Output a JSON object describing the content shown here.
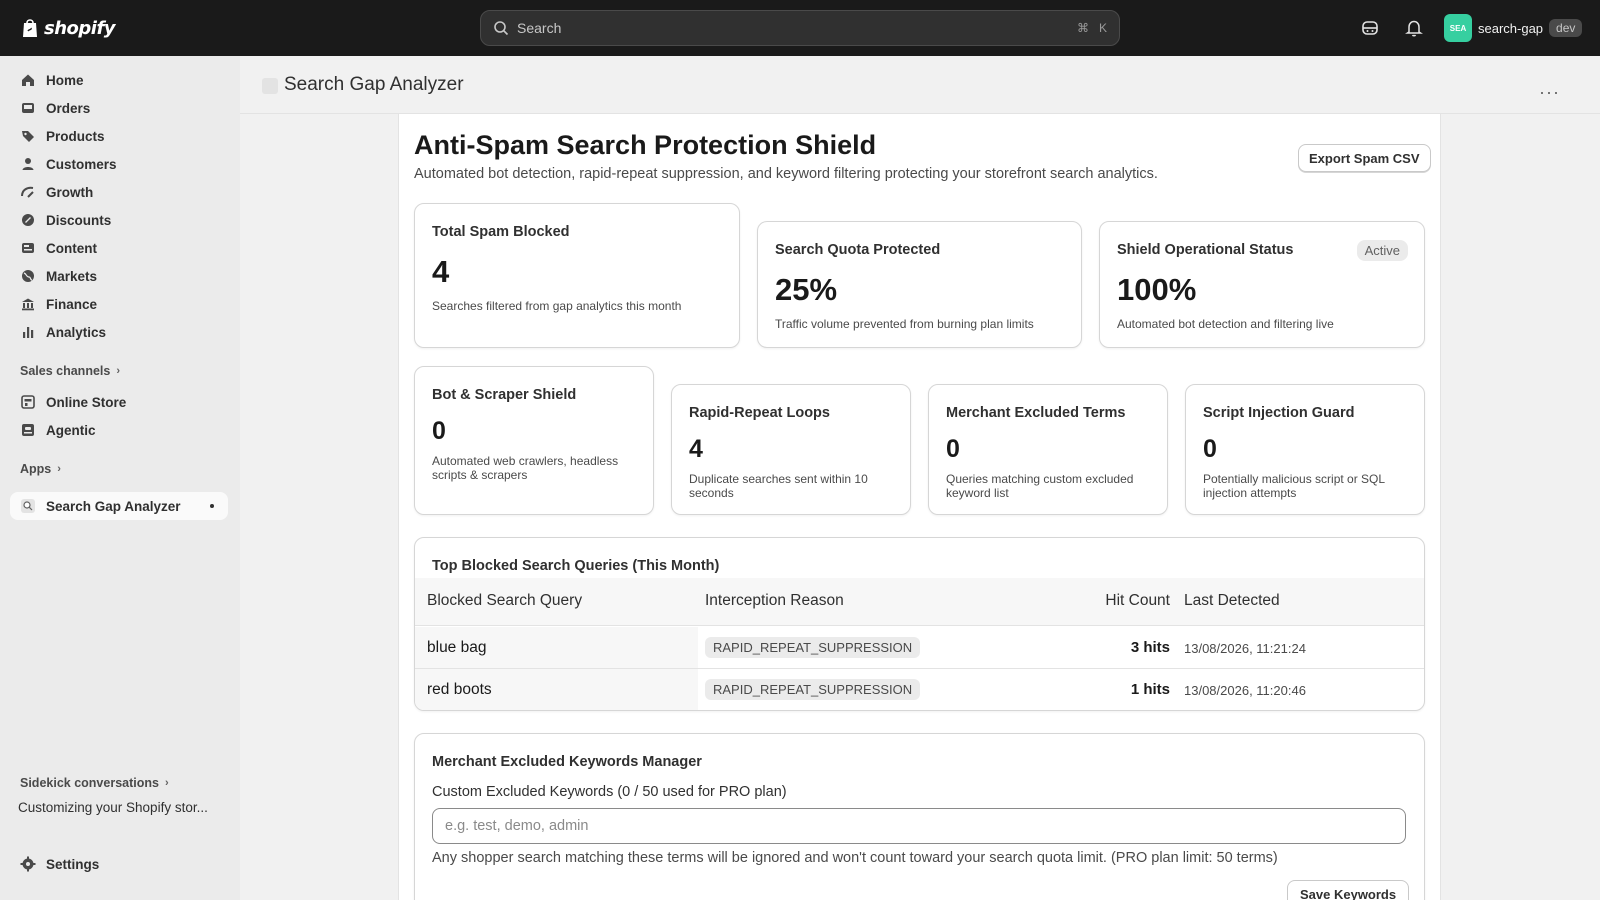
{
  "topbar": {
    "logo_text": "shopify",
    "search_placeholder": "Search",
    "shortcut_cmd": "⌘",
    "shortcut_key": "K",
    "store_initials": "SEA",
    "store_name": "search-gap",
    "store_badge": "dev"
  },
  "sidebar": {
    "items": [
      {
        "label": "Home",
        "icon": "home-icon"
      },
      {
        "label": "Orders",
        "icon": "inbox-icon"
      },
      {
        "label": "Products",
        "icon": "tag-icon"
      },
      {
        "label": "Customers",
        "icon": "person-icon"
      },
      {
        "label": "Growth",
        "icon": "growth-icon"
      },
      {
        "label": "Discounts",
        "icon": "discount-icon"
      },
      {
        "label": "Content",
        "icon": "content-icon"
      },
      {
        "label": "Markets",
        "icon": "globe-icon"
      },
      {
        "label": "Finance",
        "icon": "bank-icon"
      },
      {
        "label": "Analytics",
        "icon": "bar-chart-icon"
      }
    ],
    "sales_channels_label": "Sales channels",
    "channels": [
      {
        "label": "Online Store",
        "icon": "store-icon"
      },
      {
        "label": "Agentic",
        "icon": "agentic-icon"
      }
    ],
    "apps_label": "Apps",
    "active_app": "Search Gap Analyzer",
    "sidekick_label": "Sidekick conversations",
    "sidekick_item": "Customizing your Shopify stor...",
    "settings_label": "Settings"
  },
  "page": {
    "title": "Search Gap Analyzer",
    "more_label": "···"
  },
  "main": {
    "heading": "Anti-Spam Search Protection Shield",
    "subheading": "Automated bot detection, rapid-repeat suppression, and keyword filtering protecting your storefront search analytics.",
    "export_label": "Export Spam CSV",
    "stats_top": [
      {
        "title": "Total Spam Blocked",
        "value": "4",
        "desc": "Searches filtered from gap analytics this month"
      },
      {
        "title": "Search Quota Protected",
        "value": "25%",
        "desc": "Traffic volume prevented from burning plan limits"
      },
      {
        "title": "Shield Operational Status",
        "value": "100%",
        "desc": "Automated bot detection and filtering live",
        "badge": "Active"
      }
    ],
    "stats_bottom": [
      {
        "title": "Bot & Scraper Shield",
        "value": "0",
        "desc": "Automated web crawlers, headless scripts & scrapers"
      },
      {
        "title": "Rapid-Repeat Loops",
        "value": "4",
        "desc": "Duplicate searches sent within 10 seconds"
      },
      {
        "title": "Merchant Excluded Terms",
        "value": "0",
        "desc": "Queries matching custom excluded keyword list"
      },
      {
        "title": "Script Injection Guard",
        "value": "0",
        "desc": "Potentially malicious script or SQL injection attempts"
      }
    ],
    "table": {
      "title": "Top Blocked Search Queries (This Month)",
      "headers": [
        "Blocked Search Query",
        "Interception Reason",
        "Hit Count",
        "Last Detected"
      ],
      "rows": [
        {
          "query": "blue bag",
          "reason": "RAPID_REPEAT_SUPPRESSION",
          "hits": "3 hits",
          "last": "13/08/2026, 11:21:24"
        },
        {
          "query": "red boots",
          "reason": "RAPID_REPEAT_SUPPRESSION",
          "hits": "1 hits",
          "last": "13/08/2026, 11:20:46"
        }
      ]
    },
    "keywords": {
      "title": "Merchant Excluded Keywords Manager",
      "label": "Custom Excluded Keywords (0 / 50 used for PRO plan)",
      "placeholder": "e.g. test, demo, admin",
      "value": "",
      "help": "Any shopper search matching these terms will be ignored and won't count toward your search quota limit. (PRO plan limit: 50 terms)",
      "save_label": "Save Keywords"
    }
  }
}
